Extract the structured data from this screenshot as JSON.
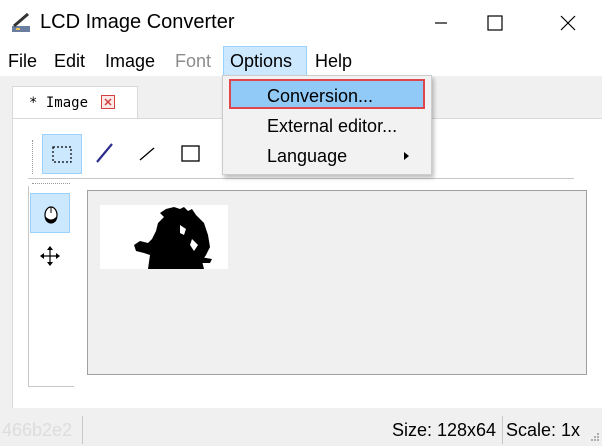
{
  "window": {
    "title": "LCD Image Converter"
  },
  "menubar": [
    {
      "label": "File",
      "state": "normal"
    },
    {
      "label": "Edit",
      "state": "normal"
    },
    {
      "label": "Image",
      "state": "normal"
    },
    {
      "label": "Font",
      "state": "disabled"
    },
    {
      "label": "Options",
      "state": "active"
    },
    {
      "label": "Help",
      "state": "normal"
    }
  ],
  "options_menu": [
    {
      "label": "Conversion...",
      "highlighted": true
    },
    {
      "label": "External editor...",
      "highlighted": false
    },
    {
      "label": "Language",
      "submenu": true
    }
  ],
  "tab": {
    "label": "* Image",
    "close_icon": "close-icon"
  },
  "toolbar": [
    "rect-select-icon",
    "pen-icon",
    "line-icon",
    "rectangle-icon"
  ],
  "side_toolbar": [
    "mouse-icon",
    "move-icon"
  ],
  "status": {
    "left_text": "466b2e2",
    "size": "Size: 128x64",
    "scale": "Scale: 1x"
  },
  "colors": {
    "highlight": "#91c9f7",
    "highlight_border": "#e0474c",
    "menu_active": "#cce8ff",
    "tool_checked": "#cce8ff"
  }
}
